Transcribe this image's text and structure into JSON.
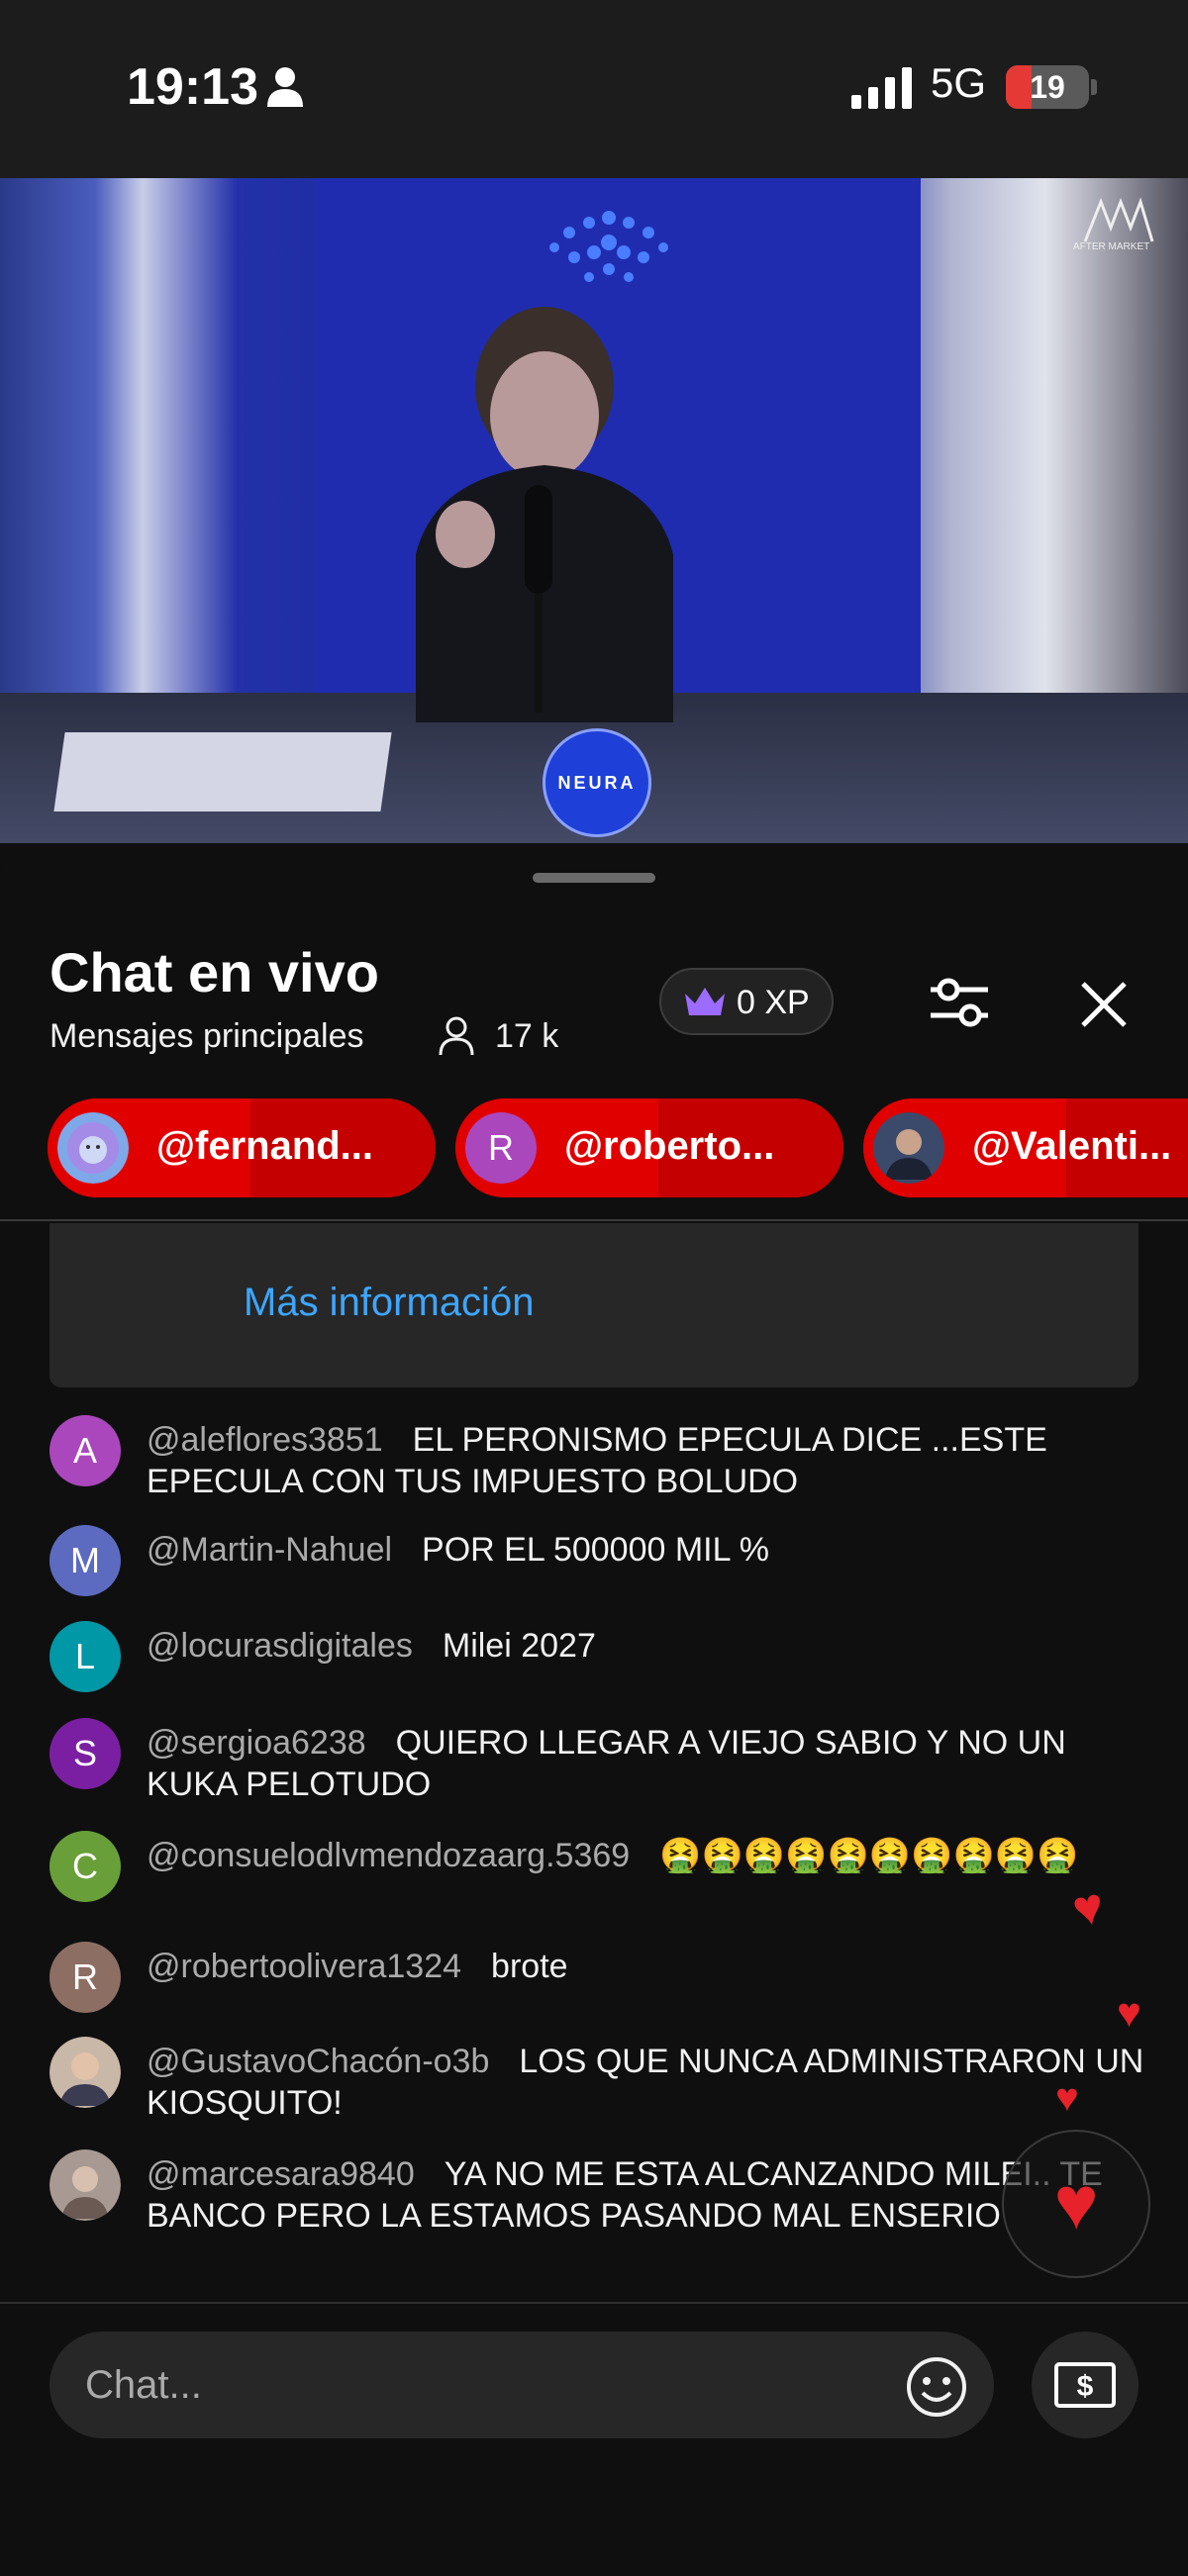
{
  "status_bar": {
    "time": "19:13",
    "network": "5G",
    "battery": "19"
  },
  "video": {
    "badge_text": "NEURA",
    "logo_text": "AFTER MARKET"
  },
  "chat_header": {
    "title": "Chat en vivo",
    "subtitle": "Mensajes principales",
    "viewers": "17 k",
    "xp": "0 XP"
  },
  "pinned": [
    {
      "label": "@fernand...",
      "avatar": "lion-avatar"
    },
    {
      "label": "@roberto...",
      "avatar_letter": "R"
    },
    {
      "label": "@Valenti...",
      "avatar": "photo-avatar"
    }
  ],
  "more_info": "Más información",
  "messages": [
    {
      "avatar_letter": "A",
      "avatar_color": "#ab47bc",
      "author": "@aleflores3851",
      "text": "EL PERONISMO EPECULA DICE ...ESTE EPECULA CON TUS IMPUESTO BOLUDO"
    },
    {
      "avatar_letter": "M",
      "avatar_color": "#5c6bc0",
      "author": "@Martin-Nahuel",
      "text": "POR EL 500000 MIL %"
    },
    {
      "avatar_letter": "L",
      "avatar_color": "#0097a7",
      "author": "@locurasdigitales",
      "text": "Milei 2027"
    },
    {
      "avatar_letter": "S",
      "avatar_color": "#7b1fa2",
      "author": "@sergioa6238",
      "text": "QUIERO LLEGAR A VIEJO SABIO Y NO UN KUKA PELOTUDO"
    },
    {
      "avatar_letter": "C",
      "avatar_color": "#689f38",
      "author": "@consuelodlvmendozaarg.5369",
      "text": "🤮🤮🤮🤮🤮🤮🤮🤮🤮🤮"
    },
    {
      "avatar_letter": "R",
      "avatar_color": "#8d6e63",
      "author": "@robertoolivera1324",
      "text": "brote"
    },
    {
      "avatar_letter": "",
      "avatar_color": "#c9b8a8",
      "author": "@GustavoChacón-o3b",
      "text": "LOS QUE NUNCA ADMINISTRARON UN KIOSQUITO!"
    },
    {
      "avatar_letter": "",
      "avatar_color": "#a89a92",
      "author": "@marcesara9840",
      "text": "YA NO ME ESTA ALCANZANDO MILEI.. TE BANCO PERO LA ESTAMOS PASANDO MAL ENSERIO"
    }
  ],
  "input": {
    "placeholder": "Chat..."
  },
  "colors": {
    "accent_red": "#d50000",
    "link_blue": "#3ea6ff",
    "background": "#0f0f0f"
  }
}
